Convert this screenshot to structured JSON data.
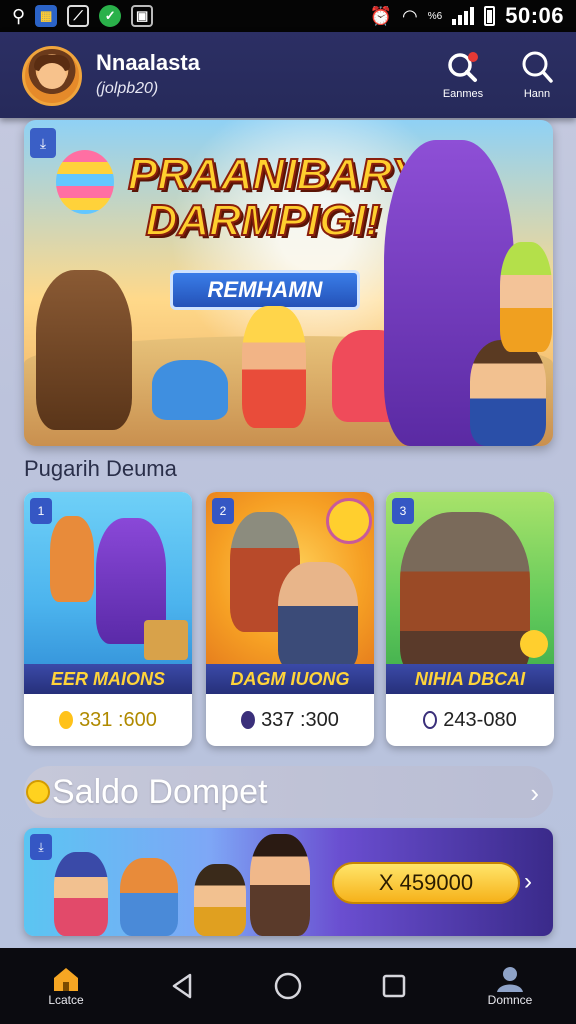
{
  "status_bar": {
    "time": "50:06",
    "network_label": "%6"
  },
  "header": {
    "user_name": "Nnaalasta",
    "user_id": "(jolpb20)",
    "search_label": "Eanmes",
    "search2_label": "Hann"
  },
  "banner": {
    "title_line1": "PRAANIBARY",
    "title_line2": "DARMPIGI!",
    "ribbon": "REMHAMN"
  },
  "section_title": "Pugarih Deuma",
  "cards": [
    {
      "badge": "1",
      "name": "EER MAIONS",
      "price": "331 :600",
      "accent": "#ffc21a"
    },
    {
      "badge": "2",
      "name": "DAGM IUONG",
      "price": "337 :300",
      "accent": "#3a2f7a"
    },
    {
      "badge": "3",
      "name": "NIHIA DBCAI",
      "price": "243-080",
      "accent": "#3a2f7a"
    }
  ],
  "wallet": {
    "label": "Saldo Dompet",
    "amount": "X 459000"
  },
  "bottom_nav": {
    "home_label": "Lcatce",
    "profile_label": "Domnce"
  },
  "colors": {
    "header": "#2c2f64",
    "accent_gold": "#ffd21f",
    "nav_bg": "#0b0b10"
  }
}
